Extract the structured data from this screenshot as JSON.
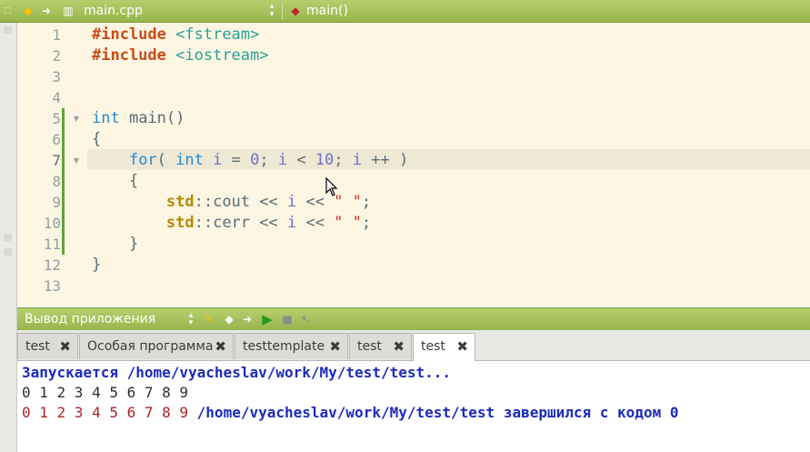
{
  "toolbar": {
    "file_name": "main.cpp",
    "function_name": "main()"
  },
  "editor": {
    "line_numbers": [
      "1",
      "2",
      "3",
      "4",
      "5",
      "6",
      "7",
      "8",
      "9",
      "10",
      "11",
      "12",
      "13"
    ],
    "lines": {
      "l1_directive": "#include",
      "l1_header": "<fstream>",
      "l2_directive": "#include",
      "l2_header": "<iostream>",
      "l5_type": "int",
      "l5_rest": " main()",
      "l6": "{",
      "l7_for": "for",
      "l7_a": "( ",
      "l7_int": "int",
      "l7_i1": "i",
      "l7_b": " = ",
      "l7_zero": "0",
      "l7_c": "; ",
      "l7_i2": "i",
      "l7_d": " < ",
      "l7_ten": "10",
      "l7_e": "; ",
      "l7_i3": "i",
      "l7_f": " ++ )",
      "l8": "{",
      "l9_ns": "std",
      "l9_a": "::cout << ",
      "l9_i": "i",
      "l9_b": " << ",
      "l9_str": "\" \"",
      "l9_c": ";",
      "l10_ns": "std",
      "l10_a": "::cerr << ",
      "l10_i": "i",
      "l10_b": " << ",
      "l10_str": "\" \"",
      "l10_c": ";",
      "l11": "}",
      "l12": "}"
    }
  },
  "output_panel": {
    "title": "Вывод приложения",
    "tabs": [
      {
        "label": "test"
      },
      {
        "label": "Особая программа"
      },
      {
        "label": "testtemplate"
      },
      {
        "label": "test"
      },
      {
        "label": "test"
      }
    ],
    "active_tab": 4,
    "lines": {
      "starting": "Запускается /home/vyacheslav/work/My/test/test...",
      "stdout": "0 1 2 3 4 5 6 7 8 9",
      "stderr": "0 1 2 3 4 5 6 7 8 9",
      "finished": " /home/vyacheslav/work/My/test/test завершился с кодом 0"
    }
  },
  "colors": {
    "toolbar_green": "#a8c45a",
    "editor_bg": "#fdf6e3",
    "current_line": "#eee8d5",
    "output_blue": "#1c2bbd",
    "output_red": "#b22222"
  }
}
